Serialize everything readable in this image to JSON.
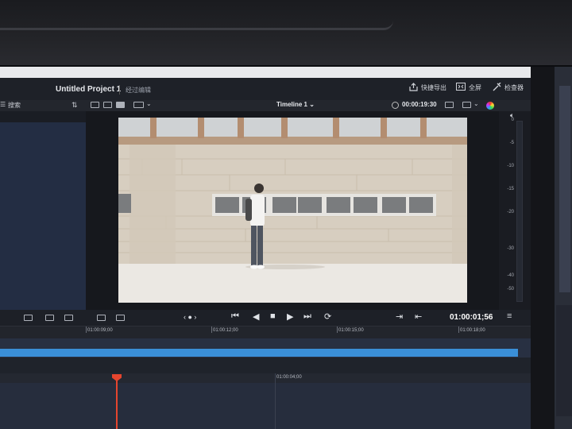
{
  "header": {
    "project_title": "Untitled Project 1",
    "project_subtitle": "经过编辑",
    "quick_export_label": "快捷导出",
    "fullscreen_label": "全屏",
    "inspector_label": "检查器"
  },
  "media_panel": {
    "search_label": "搜索"
  },
  "viewer": {
    "timeline_name": "Timeline 1",
    "timeline_chevron": "⌄",
    "source_timecode": "00:00:19:30"
  },
  "audio_meter": {
    "scale": [
      "0",
      "-5",
      "-10",
      "-15",
      "-20",
      "-30",
      "-40",
      "-50"
    ]
  },
  "transport": {
    "jog_label": "‹ ● ›",
    "current_timecode": "01:00:01;56"
  },
  "timeline": {
    "upper_ruler": [
      "01:00:09;00",
      "01:00:12;00",
      "01:00:15;00",
      "01:00:18;00"
    ],
    "lower_ruler": [
      "01:00:04;00"
    ]
  },
  "colors": {
    "accent_blue": "#3a8fd8",
    "playhead_red": "#e5452e",
    "panel_dark": "#1c1f26"
  },
  "icons": {
    "quick_export": "share-icon",
    "fullscreen": "fullscreen-icon",
    "inspector": "inspector-icon",
    "speaker": "speaker-icon"
  }
}
